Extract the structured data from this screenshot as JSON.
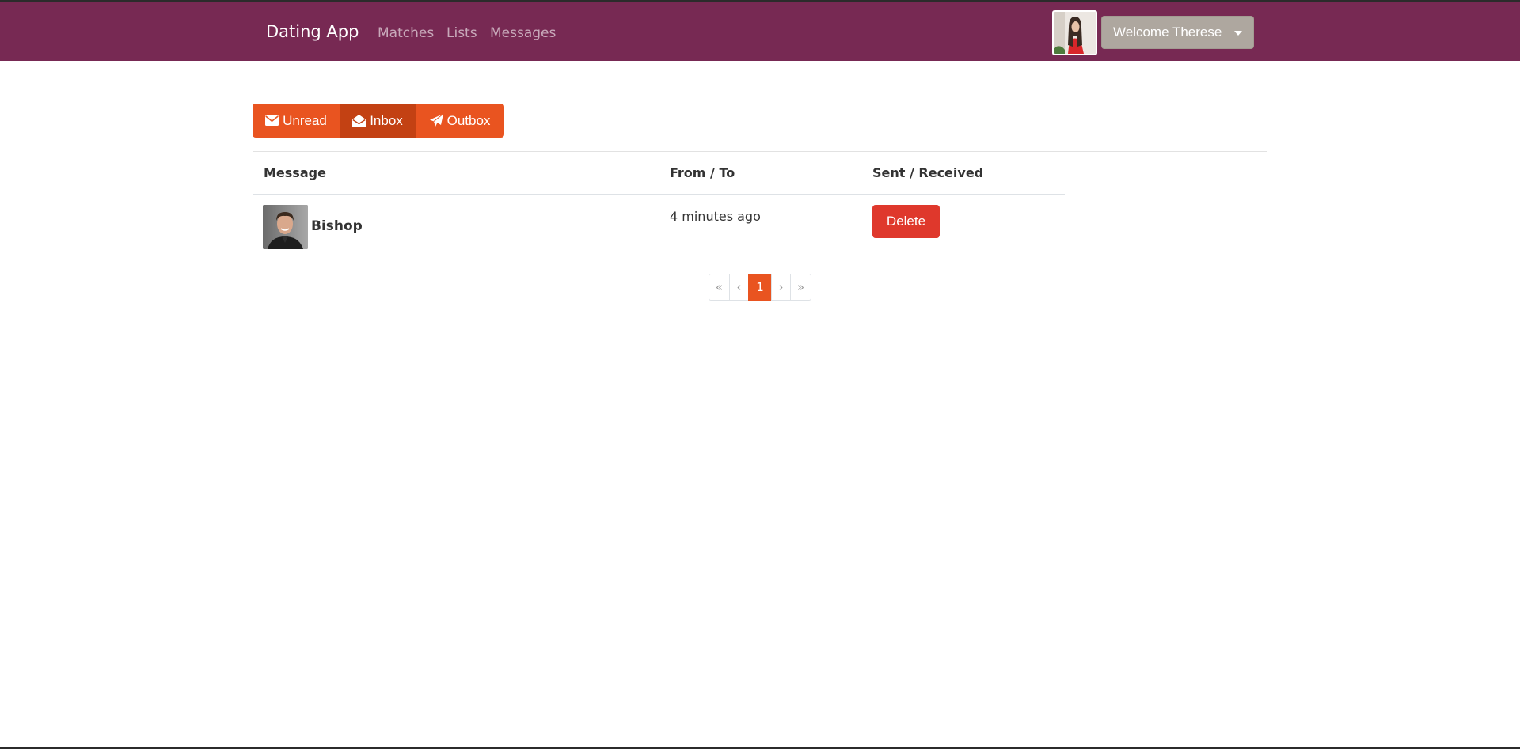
{
  "navbar": {
    "brand": "Dating App",
    "links": [
      {
        "label": "Matches"
      },
      {
        "label": "Lists"
      },
      {
        "label": "Messages"
      }
    ],
    "welcome_label": "Welcome Therese"
  },
  "message_tabs": [
    {
      "label": "Unread",
      "icon": "envelope-icon",
      "active": false
    },
    {
      "label": "Inbox",
      "icon": "envelope-open-icon",
      "active": true
    },
    {
      "label": "Outbox",
      "icon": "paper-plane-icon",
      "active": false
    }
  ],
  "table": {
    "headers": [
      "Message",
      "From / To",
      "Sent / Received"
    ],
    "rows": [
      {
        "name": "Bishop",
        "time": "4 minutes ago",
        "delete_label": "Delete"
      }
    ]
  },
  "pagination": {
    "first": "«",
    "prev": "‹",
    "current": "1",
    "next": "›",
    "last": "»"
  },
  "colors": {
    "navbar": "#772953",
    "primary": "#e95420",
    "primary_active": "#c34113",
    "danger": "#df382c",
    "secondary": "#aea79f"
  }
}
